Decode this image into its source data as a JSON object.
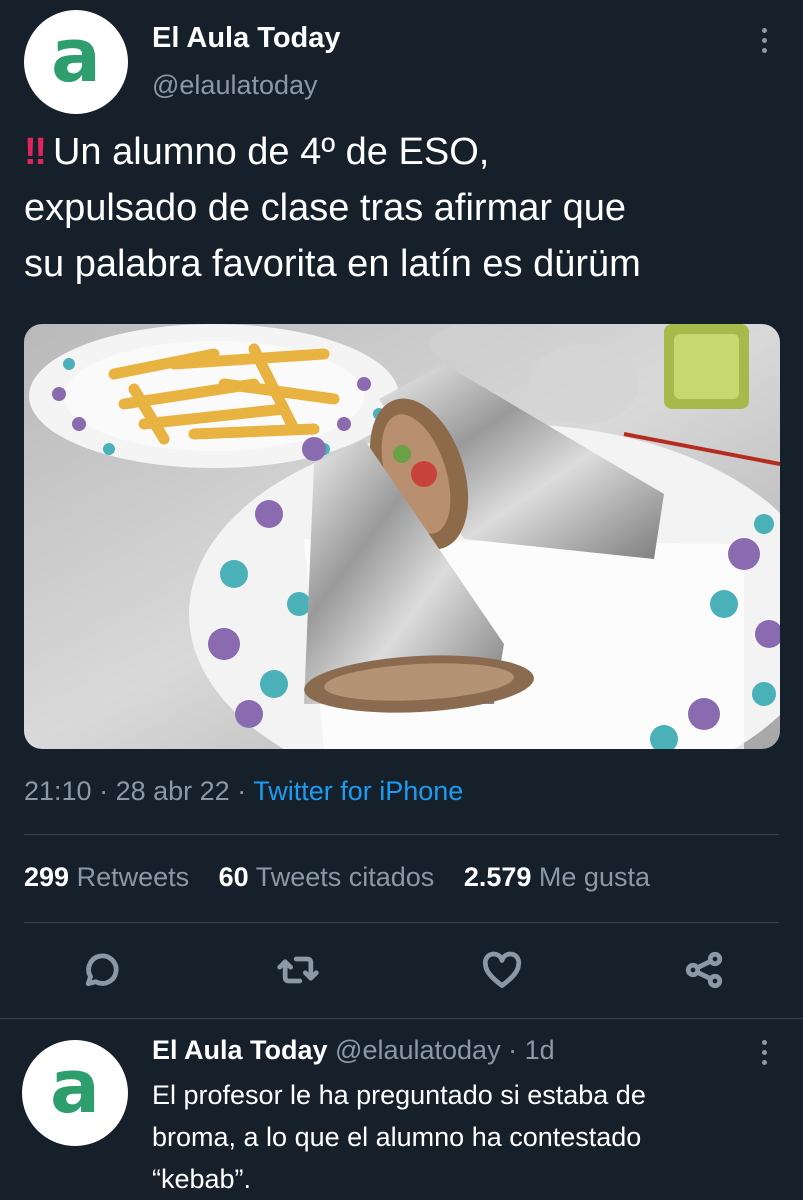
{
  "tweet": {
    "avatar_letter": "a",
    "author_name": "El Aula Today",
    "author_handle": "@elaulatoday",
    "emoji": "‼",
    "text_lines": [
      "Un alumno de 4º de ESO,",
      "expulsado de clase tras afirmar que",
      "su palabra favorita en latín es dürüm"
    ],
    "media_description_icon": "photo-kebab-icon",
    "time": "21:10",
    "date": "28 abr 22",
    "source": "Twitter for iPhone",
    "stats": {
      "retweets_count": "299",
      "retweets_label": "Retweets",
      "quotes_count": "60",
      "quotes_label": "Tweets citados",
      "likes_count": "2.579",
      "likes_label": "Me gusta"
    }
  },
  "actions": [
    "reply-icon",
    "retweet-icon",
    "like-icon",
    "share-icon"
  ],
  "reply": {
    "avatar_letter": "a",
    "author_name": "El Aula Today",
    "author_handle": "@elaulatoday",
    "age": "1d",
    "text_lines": [
      "El profesor le ha preguntado si estaba de",
      "broma, a lo que el alumno ha contestado",
      "“kebab”."
    ]
  },
  "colors": {
    "background": "#15202b",
    "secondary_text": "#8b98a5",
    "link": "#1d9bf0",
    "divider": "#38444d",
    "avatar_letter": "#2e9e6e"
  }
}
